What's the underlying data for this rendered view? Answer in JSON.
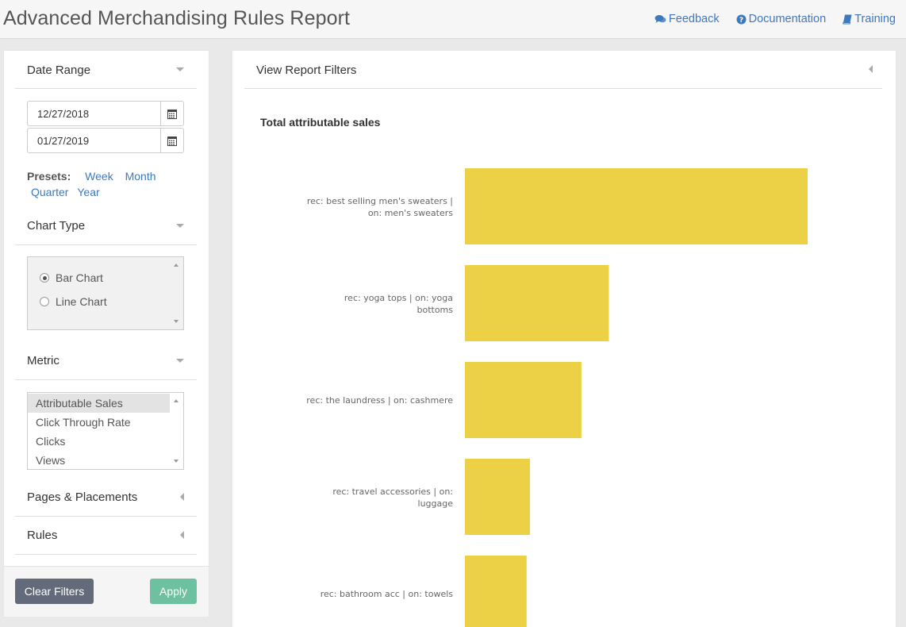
{
  "header": {
    "title": "Advanced Merchandising Rules Report",
    "links": [
      {
        "label": "Feedback",
        "icon": "comments-icon"
      },
      {
        "label": "Documentation",
        "icon": "question-circle-icon"
      },
      {
        "label": "Training",
        "icon": "book-icon"
      }
    ]
  },
  "sidebar": {
    "date_range": {
      "title": "Date Range",
      "start": "12/27/2018",
      "end": "01/27/2019",
      "presets_label": "Presets:",
      "presets": [
        "Week",
        "Month",
        "Quarter",
        "Year"
      ]
    },
    "chart_type": {
      "title": "Chart Type",
      "options": [
        {
          "label": "Bar Chart",
          "checked": true
        },
        {
          "label": "Line Chart",
          "checked": false
        }
      ]
    },
    "metric": {
      "title": "Metric",
      "options": [
        "Attributable Sales",
        "Click Through Rate",
        "Clicks",
        "Views"
      ],
      "selected": "Attributable Sales"
    },
    "pages_placements": {
      "title": "Pages & Placements"
    },
    "rules": {
      "title": "Rules"
    },
    "footer": {
      "clear_label": "Clear Filters",
      "apply_label": "Apply"
    }
  },
  "main": {
    "filters_title": "View Report Filters"
  },
  "chart_data": {
    "type": "bar",
    "orientation": "horizontal",
    "title": "Total attributable sales",
    "color": "#ecd046",
    "categories": [
      "rec: best selling men's sweaters | on: men's sweaters",
      "rec: yoga tops | on: yoga bottoms",
      "rec: the laundress | on: cashmere",
      "rec: travel accessories | on: luggage",
      "rec: bathroom acc | on: towels"
    ],
    "values": [
      100,
      42,
      34,
      19,
      18
    ],
    "xlabel": "",
    "ylabel": "",
    "grid": false,
    "legend": "none"
  },
  "colors": {
    "accent_link": "#3d79bd",
    "bar": "#ecd046",
    "clear_button": "#636a7a",
    "apply_button": "#6ec1a0"
  }
}
